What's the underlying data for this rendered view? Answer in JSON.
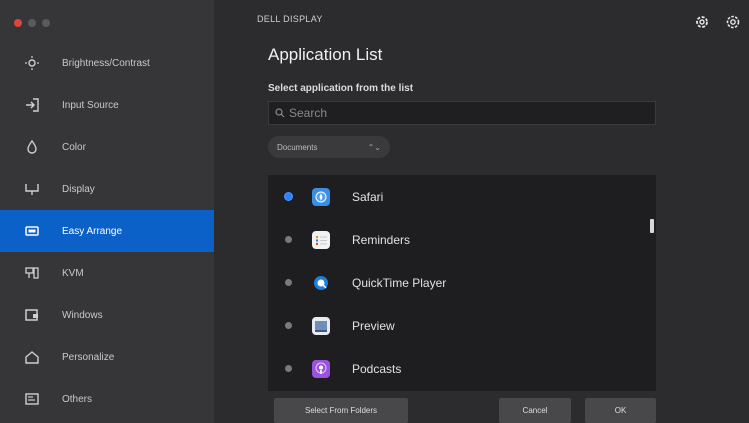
{
  "window": {
    "traffic_lights": [
      "close",
      "minimize",
      "zoom"
    ]
  },
  "header": {
    "breadcrumb": "DELL DISPLAY",
    "icons": [
      "gear-icon",
      "settings-icon"
    ]
  },
  "sidebar": {
    "items": [
      {
        "label": "Brightness/Contrast",
        "icon": "brightness-icon",
        "active": false
      },
      {
        "label": "Input Source",
        "icon": "input-source-icon",
        "active": false
      },
      {
        "label": "Color",
        "icon": "color-icon",
        "active": false
      },
      {
        "label": "Display",
        "icon": "display-icon",
        "active": false
      },
      {
        "label": "Easy Arrange",
        "icon": "easy-arrange-icon",
        "active": true
      },
      {
        "label": "KVM",
        "icon": "kvm-icon",
        "active": false
      },
      {
        "label": "Windows",
        "icon": "windows-icon",
        "active": false
      },
      {
        "label": "Personalize",
        "icon": "personalize-icon",
        "active": false
      },
      {
        "label": "Others",
        "icon": "others-icon",
        "active": false
      }
    ]
  },
  "main": {
    "title": "Application List",
    "subtitle": "Select application from the list",
    "search": {
      "placeholder": "Search",
      "value": ""
    },
    "filter": {
      "selected": "Documents"
    },
    "apps": [
      {
        "name": "Safari",
        "icon": "safari-icon",
        "color": "#3a8ee6",
        "selected": true
      },
      {
        "name": "Reminders",
        "icon": "reminders-icon",
        "color": "#f2f2f2",
        "selected": false
      },
      {
        "name": "QuickTime Player",
        "icon": "quicktime-icon",
        "color": "#1d7fd8",
        "selected": false
      },
      {
        "name": "Preview",
        "icon": "preview-icon",
        "color": "#6f8fb8",
        "selected": false
      },
      {
        "name": "Podcasts",
        "icon": "podcasts-icon",
        "color": "#9b52e0",
        "selected": false
      }
    ]
  },
  "footer": {
    "select_folder_label": "Select From Folders",
    "cancel_label": "Cancel",
    "ok_label": "OK"
  },
  "colors": {
    "accent": "#0b61c8",
    "background": "#2c2c2e",
    "sidebar": "#363638",
    "list_bg": "#1e1e20"
  }
}
